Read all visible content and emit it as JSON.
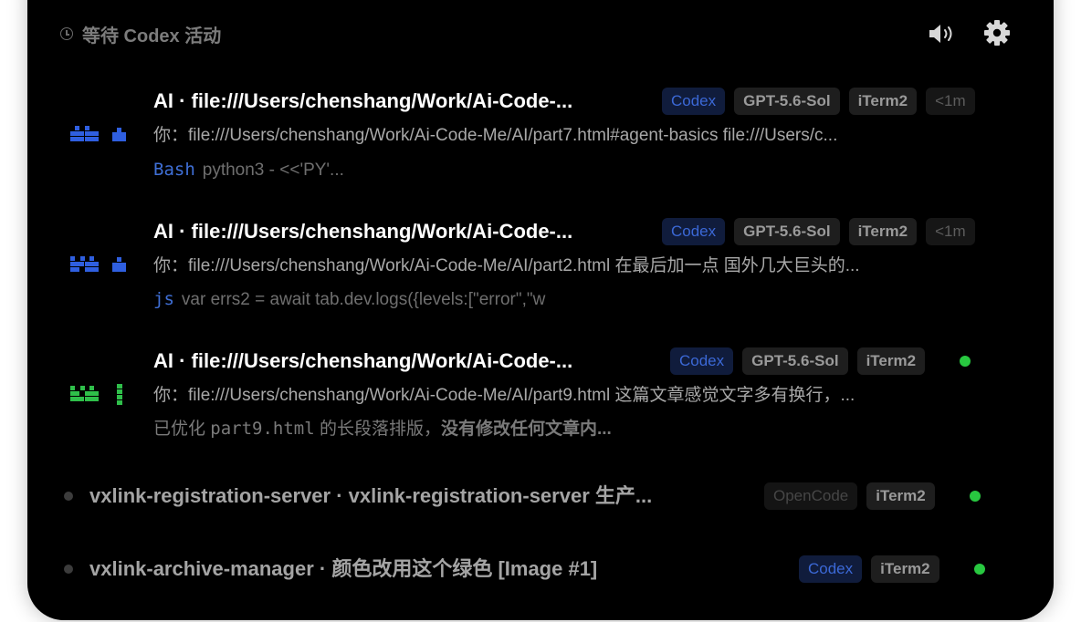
{
  "header": {
    "title": "等待 Codex 活动",
    "clock_icon": "clock-icon",
    "speaker_icon": "speaker-icon",
    "gear_icon": "gear-icon"
  },
  "colors": {
    "background": "#000000",
    "codex_badge": "#3b68d6",
    "status_green": "#28c840",
    "tool_blue": "#3f6fd6"
  },
  "sessions": [
    {
      "title": "AI · file:///Users/chenshang/Work/Ai-Code-...",
      "prompt": "你：file:///Users/chenshang/Work/Ai-Code-Me/AI/part7.html#agent-basics file:///Users/c...",
      "tool": "Bash",
      "activity": "python3 - <<'PY'...",
      "badges": [
        "Codex",
        "GPT-5.6-Sol",
        "iTerm2",
        "<1m"
      ],
      "avatar_color": "#2f5fe0",
      "avatar_icon": "pixel-avatar-icon"
    },
    {
      "title": "AI · file:///Users/chenshang/Work/Ai-Code-...",
      "prompt": "你：file:///Users/chenshang/Work/Ai-Code-Me/AI/part2.html 在最后加一点 国外几大巨头的...",
      "tool": "js",
      "activity": "var errs2 = await tab.dev.logs({levels:[\"error\",\"w",
      "badges": [
        "Codex",
        "GPT-5.6-Sol",
        "iTerm2",
        "<1m"
      ],
      "avatar_color": "#2f5fe0",
      "avatar_icon": "pixel-avatar-icon"
    },
    {
      "title": "AI · file:///Users/chenshang/Work/Ai-Code-...",
      "prompt": "你：file:///Users/chenshang/Work/Ai-Code-Me/AI/part9.html 这篇文章感觉文字多有换行，...",
      "activity_a": "已优化 ",
      "activity_code": "part9.html",
      "activity_b": " 的长段落排版，",
      "activity_bold": "没有修改任何文章内...",
      "badges": [
        "Codex",
        "GPT-5.6-Sol",
        "iTerm2"
      ],
      "avatar_color": "#2fbf4a",
      "avatar_icon": "pixel-avatar-icon",
      "status": "active"
    }
  ],
  "mini_sessions": [
    {
      "title": "vxlink-registration-server · vxlink-registration-server 生产...",
      "badges": [
        "OpenCode",
        "iTerm2"
      ],
      "status": "active"
    },
    {
      "title": "vxlink-archive-manager · 颜色改用这个绿色 [Image #1]",
      "badges": [
        "Codex",
        "iTerm2"
      ],
      "status": "active"
    }
  ]
}
